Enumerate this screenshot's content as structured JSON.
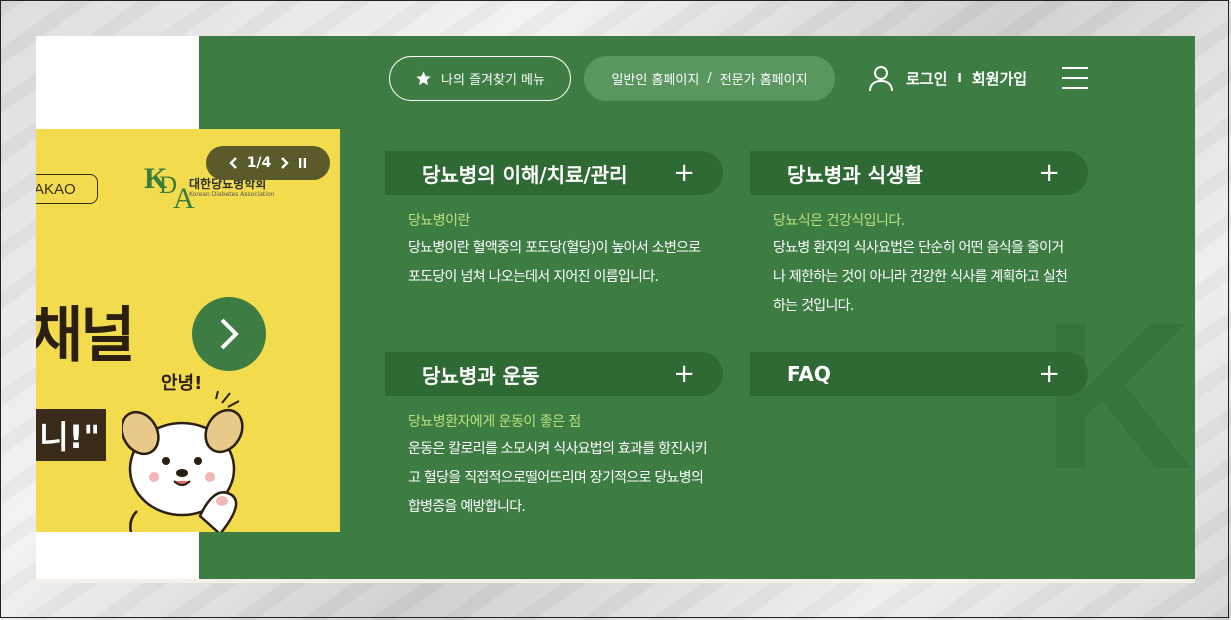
{
  "top_bar": {
    "favorites_label": "나의 즐겨찾기 메뉴",
    "general_home": "일반인 홈페이지",
    "separator": "/",
    "expert_home": "전문가 홈페이지",
    "login": "로그인",
    "divider": "I",
    "signup": "회원가입"
  },
  "banner": {
    "counter": "1/4",
    "kakao_text": "AKAO",
    "logo": {
      "k": "K",
      "d": "D",
      "a": "A",
      "name": "대한당뇨병학회",
      "english": "Korean Diabetes Association"
    },
    "headline": "채널",
    "greeting": "안녕!",
    "quote": "니!\""
  },
  "cards": [
    {
      "title": "당뇨병의 이해/치료/관리",
      "subtitle": "당뇨병이란",
      "description": "당뇨병이란 혈액중의 포도당(혈당)이 높아서 소변으로 포도당이 넘쳐 나오는데서 지어진 이름입니다."
    },
    {
      "title": "당뇨병과 식생활",
      "subtitle": "당뇨식은 건강식입니다.",
      "description": "당뇨병 환자의 식사요법은 단순히 어떤 음식을 줄이거나 제한하는 것이 아니라 건강한 식사를 계획하고 실천하는 것입니다."
    },
    {
      "title": "당뇨병과 운동",
      "subtitle": "당뇨병환자에게 운동이 좋은 점",
      "description": "운동은 칼로리를 소모시켜 식사요법의 효과를 항진시키고 혈당을 직접적으로떨어뜨리며 장기적으로 당뇨병의 합병증을 예방합니다."
    },
    {
      "title": "FAQ",
      "subtitle": "",
      "description": ""
    }
  ],
  "colors": {
    "panel_green": "#3d7d43",
    "card_header": "#2f6a35",
    "accent_text": "#b8e07e",
    "banner_yellow": "#f2dc4e"
  }
}
